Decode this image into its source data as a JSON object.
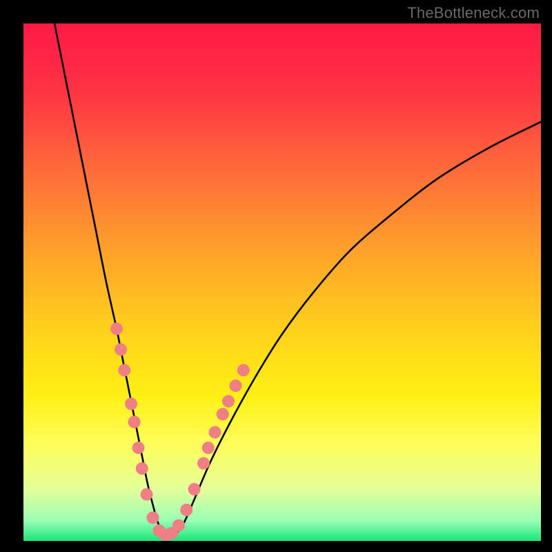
{
  "watermark": "TheBottleneck.com",
  "chart_data": {
    "type": "line",
    "title": "",
    "xlabel": "",
    "ylabel": "",
    "xlim": [
      0,
      100
    ],
    "ylim": [
      0,
      100
    ],
    "background_gradient_stops": [
      {
        "pos": 0.0,
        "color": "#ff1a46"
      },
      {
        "pos": 0.12,
        "color": "#ff3044"
      },
      {
        "pos": 0.28,
        "color": "#ff6a3a"
      },
      {
        "pos": 0.45,
        "color": "#ffa529"
      },
      {
        "pos": 0.6,
        "color": "#ffd31a"
      },
      {
        "pos": 0.72,
        "color": "#fff015"
      },
      {
        "pos": 0.82,
        "color": "#fdff60"
      },
      {
        "pos": 0.9,
        "color": "#e4ff9a"
      },
      {
        "pos": 0.96,
        "color": "#9bffb4"
      },
      {
        "pos": 1.0,
        "color": "#19e57a"
      }
    ],
    "series": [
      {
        "name": "bottleneck-curve",
        "x": [
          6,
          8,
          10,
          12,
          14,
          16,
          18,
          19,
          20,
          21,
          22,
          23,
          24,
          25,
          26,
          27,
          28,
          29.5,
          31,
          33,
          36,
          40,
          45,
          50,
          56,
          63,
          71,
          80,
          90,
          100
        ],
        "y": [
          100,
          90,
          80,
          70,
          60,
          50,
          41,
          36,
          31,
          26,
          21,
          16,
          11,
          7,
          3.5,
          1.5,
          1,
          1.5,
          3.5,
          8,
          15,
          23,
          32,
          40,
          48,
          56,
          63,
          70,
          76,
          81
        ]
      }
    ],
    "marker_points": {
      "name": "curve-markers",
      "color": "#ef7f84",
      "radius": 9,
      "points": [
        {
          "x": 18.0,
          "y": 41.0
        },
        {
          "x": 18.8,
          "y": 37.0
        },
        {
          "x": 19.5,
          "y": 33.0
        },
        {
          "x": 20.8,
          "y": 26.5
        },
        {
          "x": 21.4,
          "y": 23.0
        },
        {
          "x": 22.2,
          "y": 18.0
        },
        {
          "x": 22.9,
          "y": 14.0
        },
        {
          "x": 23.8,
          "y": 9.0
        },
        {
          "x": 25.0,
          "y": 4.5
        },
        {
          "x": 26.2,
          "y": 2.0
        },
        {
          "x": 27.4,
          "y": 1.2
        },
        {
          "x": 28.7,
          "y": 1.5
        },
        {
          "x": 30.0,
          "y": 3.0
        },
        {
          "x": 31.5,
          "y": 6.0
        },
        {
          "x": 33.0,
          "y": 10.0
        },
        {
          "x": 34.8,
          "y": 15.0
        },
        {
          "x": 35.7,
          "y": 18.0
        },
        {
          "x": 37.0,
          "y": 21.0
        },
        {
          "x": 38.5,
          "y": 24.5
        },
        {
          "x": 39.6,
          "y": 27.0
        },
        {
          "x": 41.0,
          "y": 30.0
        },
        {
          "x": 42.5,
          "y": 33.0
        }
      ]
    }
  }
}
